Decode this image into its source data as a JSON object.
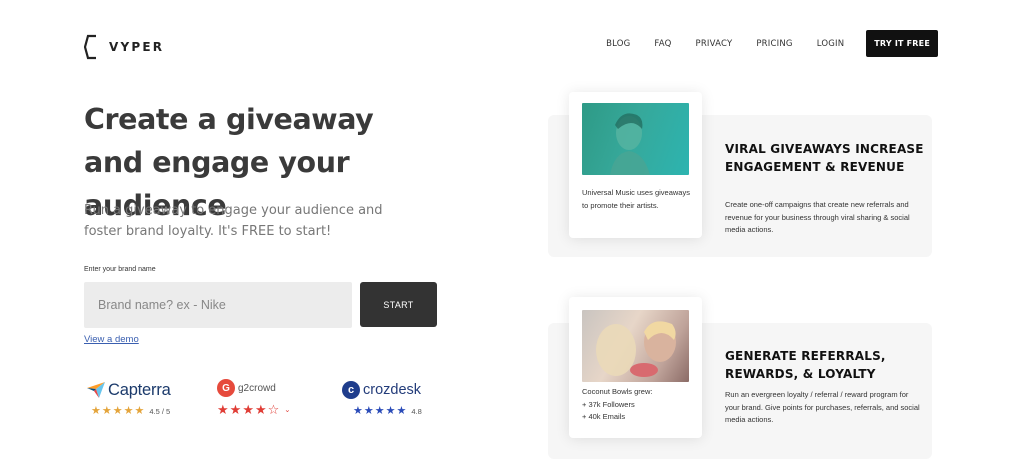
{
  "header": {
    "logo_text": "VYPER",
    "nav": [
      {
        "label": "BLOG"
      },
      {
        "label": "FAQ"
      },
      {
        "label": "PRIVACY"
      },
      {
        "label": "PRICING"
      },
      {
        "label": "LOGIN"
      }
    ],
    "cta_label": "TRY IT FREE"
  },
  "hero": {
    "headline": "Create a giveaway and engage your audience",
    "subtext": "Run a giveaway to engage your audience and foster brand loyalty. It's FREE to start!",
    "input_label": "Enter your brand name",
    "input_placeholder": "Brand name? ex - Nike",
    "input_value": "",
    "start_label": "START",
    "demo_link": "View a demo"
  },
  "ratings": [
    {
      "brand": "Capterra",
      "score_text": "4.5 / 5",
      "stars": 4.5,
      "color": "#e4a43a",
      "icon": "capterra-arrow-icon"
    },
    {
      "brand": "g2crowd",
      "score_text": "",
      "stars": 4.5,
      "color": "#e03d36",
      "icon": "g2-badge-icon"
    },
    {
      "brand": "crozdesk",
      "score_text": "4.8",
      "stars": 4.8,
      "color": "#2a4bb8",
      "icon": "crozdesk-badge-icon"
    }
  ],
  "features": [
    {
      "card_caption": "Universal Music uses giveaways to promote their artists.",
      "title": "VIRAL GIVEAWAYS INCREASE ENGAGEMENT & REVENUE",
      "description": "Create one-off campaigns that create new referrals and revenue for your business through viral sharing & social media actions."
    },
    {
      "card_caption_lines": [
        "Coconut Bowls grew:",
        "+ 37k Followers",
        "+ 40k Emails"
      ],
      "title": "GENERATE REFERRALS, REWARDS, & LOYALTY",
      "description": "Run an evergreen loyalty / referral / reward program for your brand. Give points for purchases, referrals, and social media actions."
    }
  ],
  "colors": {
    "cta_bg": "#111111",
    "start_bg": "#333333",
    "input_bg": "#ececec",
    "link": "#3a5fb0",
    "feature_panel_bg": "#f6f6f6"
  }
}
